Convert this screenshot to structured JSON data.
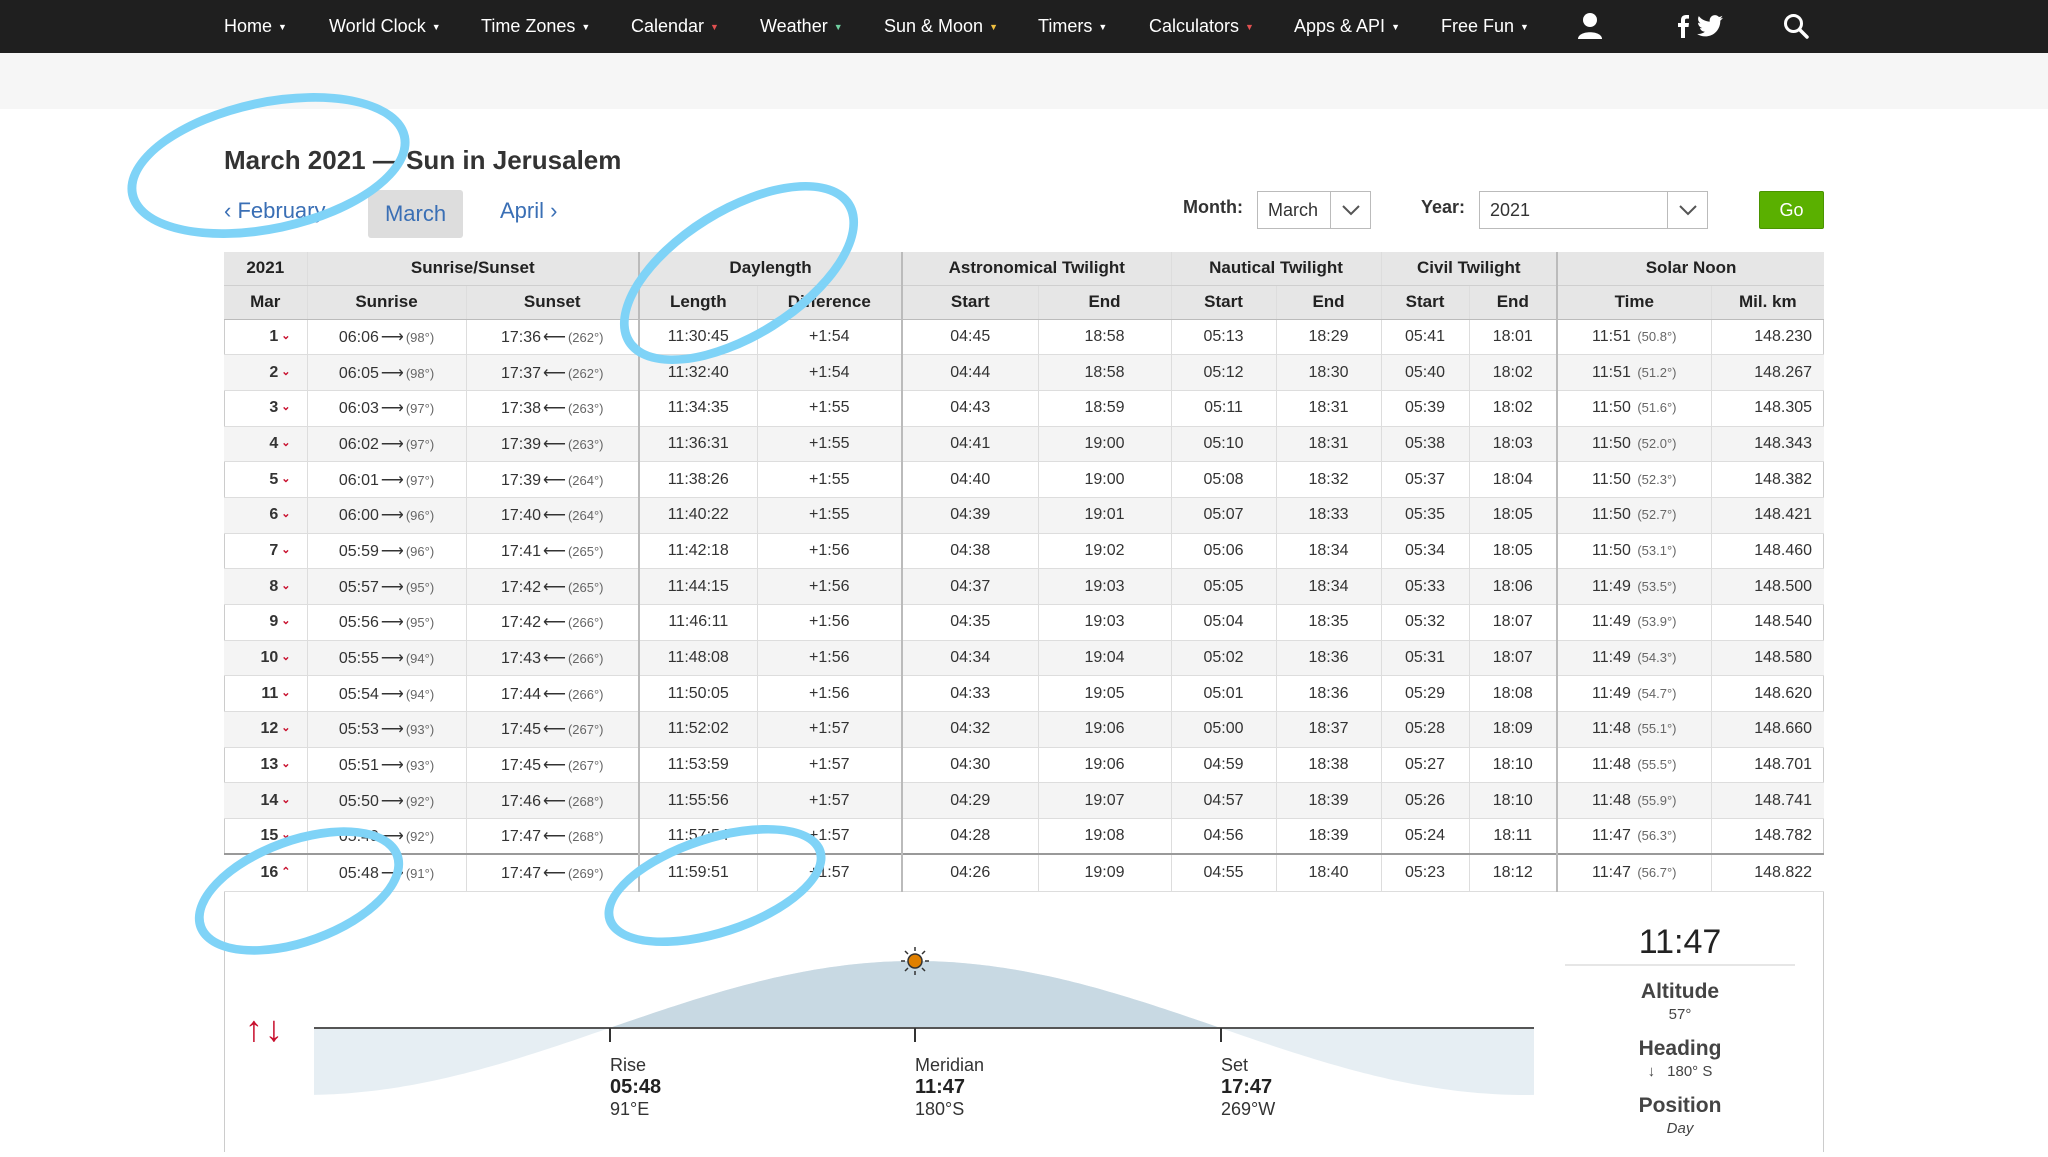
{
  "nav": {
    "items": [
      "Home",
      "World Clock",
      "Time Zones",
      "Calendar",
      "Weather",
      "Sun & Moon",
      "Timers",
      "Calculators",
      "Apps & API",
      "Free Fun"
    ],
    "icons": [
      "user-icon",
      "facebook-icon",
      "twitter-icon",
      "search-icon"
    ]
  },
  "page": {
    "title": "March 2021 — Sun in Jerusalem",
    "prev_month": "February",
    "current_month": "March",
    "next_month": "April"
  },
  "form": {
    "month_label": "Month:",
    "month_value": "March",
    "year_label": "Year:",
    "year_value": "2021",
    "go_label": "Go"
  },
  "table": {
    "group_headers": [
      "2021",
      "Sunrise/Sunset",
      "Daylength",
      "Astronomical Twilight",
      "Nautical Twilight",
      "Civil Twilight",
      "Solar Noon"
    ],
    "col_headers": [
      "Mar",
      "Sunrise",
      "Sunset",
      "Length",
      "Difference",
      "Start",
      "End",
      "Start",
      "End",
      "Start",
      "End",
      "Time",
      "Mil. km"
    ],
    "rows": [
      {
        "day": "1",
        "sunrise": "06:06",
        "sr_az": "(98°)",
        "sunset": "17:36",
        "ss_az": "(262°)",
        "length": "11:30:45",
        "diff": "+1:54",
        "astro_start": "04:45",
        "astro_end": "18:58",
        "naut_start": "05:13",
        "naut_end": "18:29",
        "civil_start": "05:41",
        "civil_end": "18:01",
        "noon": "11:51",
        "noon_alt": "(50.8°)",
        "dist": "148.230"
      },
      {
        "day": "2",
        "sunrise": "06:05",
        "sr_az": "(98°)",
        "sunset": "17:37",
        "ss_az": "(262°)",
        "length": "11:32:40",
        "diff": "+1:54",
        "astro_start": "04:44",
        "astro_end": "18:58",
        "naut_start": "05:12",
        "naut_end": "18:30",
        "civil_start": "05:40",
        "civil_end": "18:02",
        "noon": "11:51",
        "noon_alt": "(51.2°)",
        "dist": "148.267"
      },
      {
        "day": "3",
        "sunrise": "06:03",
        "sr_az": "(97°)",
        "sunset": "17:38",
        "ss_az": "(263°)",
        "length": "11:34:35",
        "diff": "+1:55",
        "astro_start": "04:43",
        "astro_end": "18:59",
        "naut_start": "05:11",
        "naut_end": "18:31",
        "civil_start": "05:39",
        "civil_end": "18:02",
        "noon": "11:50",
        "noon_alt": "(51.6°)",
        "dist": "148.305"
      },
      {
        "day": "4",
        "sunrise": "06:02",
        "sr_az": "(97°)",
        "sunset": "17:39",
        "ss_az": "(263°)",
        "length": "11:36:31",
        "diff": "+1:55",
        "astro_start": "04:41",
        "astro_end": "19:00",
        "naut_start": "05:10",
        "naut_end": "18:31",
        "civil_start": "05:38",
        "civil_end": "18:03",
        "noon": "11:50",
        "noon_alt": "(52.0°)",
        "dist": "148.343"
      },
      {
        "day": "5",
        "sunrise": "06:01",
        "sr_az": "(97°)",
        "sunset": "17:39",
        "ss_az": "(264°)",
        "length": "11:38:26",
        "diff": "+1:55",
        "astro_start": "04:40",
        "astro_end": "19:00",
        "naut_start": "05:08",
        "naut_end": "18:32",
        "civil_start": "05:37",
        "civil_end": "18:04",
        "noon": "11:50",
        "noon_alt": "(52.3°)",
        "dist": "148.382"
      },
      {
        "day": "6",
        "sunrise": "06:00",
        "sr_az": "(96°)",
        "sunset": "17:40",
        "ss_az": "(264°)",
        "length": "11:40:22",
        "diff": "+1:55",
        "astro_start": "04:39",
        "astro_end": "19:01",
        "naut_start": "05:07",
        "naut_end": "18:33",
        "civil_start": "05:35",
        "civil_end": "18:05",
        "noon": "11:50",
        "noon_alt": "(52.7°)",
        "dist": "148.421"
      },
      {
        "day": "7",
        "sunrise": "05:59",
        "sr_az": "(96°)",
        "sunset": "17:41",
        "ss_az": "(265°)",
        "length": "11:42:18",
        "diff": "+1:56",
        "astro_start": "04:38",
        "astro_end": "19:02",
        "naut_start": "05:06",
        "naut_end": "18:34",
        "civil_start": "05:34",
        "civil_end": "18:05",
        "noon": "11:50",
        "noon_alt": "(53.1°)",
        "dist": "148.460"
      },
      {
        "day": "8",
        "sunrise": "05:57",
        "sr_az": "(95°)",
        "sunset": "17:42",
        "ss_az": "(265°)",
        "length": "11:44:15",
        "diff": "+1:56",
        "astro_start": "04:37",
        "astro_end": "19:03",
        "naut_start": "05:05",
        "naut_end": "18:34",
        "civil_start": "05:33",
        "civil_end": "18:06",
        "noon": "11:49",
        "noon_alt": "(53.5°)",
        "dist": "148.500"
      },
      {
        "day": "9",
        "sunrise": "05:56",
        "sr_az": "(95°)",
        "sunset": "17:42",
        "ss_az": "(266°)",
        "length": "11:46:11",
        "diff": "+1:56",
        "astro_start": "04:35",
        "astro_end": "19:03",
        "naut_start": "05:04",
        "naut_end": "18:35",
        "civil_start": "05:32",
        "civil_end": "18:07",
        "noon": "11:49",
        "noon_alt": "(53.9°)",
        "dist": "148.540"
      },
      {
        "day": "10",
        "sunrise": "05:55",
        "sr_az": "(94°)",
        "sunset": "17:43",
        "ss_az": "(266°)",
        "length": "11:48:08",
        "diff": "+1:56",
        "astro_start": "04:34",
        "astro_end": "19:04",
        "naut_start": "05:02",
        "naut_end": "18:36",
        "civil_start": "05:31",
        "civil_end": "18:07",
        "noon": "11:49",
        "noon_alt": "(54.3°)",
        "dist": "148.580"
      },
      {
        "day": "11",
        "sunrise": "05:54",
        "sr_az": "(94°)",
        "sunset": "17:44",
        "ss_az": "(266°)",
        "length": "11:50:05",
        "diff": "+1:56",
        "astro_start": "04:33",
        "astro_end": "19:05",
        "naut_start": "05:01",
        "naut_end": "18:36",
        "civil_start": "05:29",
        "civil_end": "18:08",
        "noon": "11:49",
        "noon_alt": "(54.7°)",
        "dist": "148.620"
      },
      {
        "day": "12",
        "sunrise": "05:53",
        "sr_az": "(93°)",
        "sunset": "17:45",
        "ss_az": "(267°)",
        "length": "11:52:02",
        "diff": "+1:57",
        "astro_start": "04:32",
        "astro_end": "19:06",
        "naut_start": "05:00",
        "naut_end": "18:37",
        "civil_start": "05:28",
        "civil_end": "18:09",
        "noon": "11:48",
        "noon_alt": "(55.1°)",
        "dist": "148.660"
      },
      {
        "day": "13",
        "sunrise": "05:51",
        "sr_az": "(93°)",
        "sunset": "17:45",
        "ss_az": "(267°)",
        "length": "11:53:59",
        "diff": "+1:57",
        "astro_start": "04:30",
        "astro_end": "19:06",
        "naut_start": "04:59",
        "naut_end": "18:38",
        "civil_start": "05:27",
        "civil_end": "18:10",
        "noon": "11:48",
        "noon_alt": "(55.5°)",
        "dist": "148.701"
      },
      {
        "day": "14",
        "sunrise": "05:50",
        "sr_az": "(92°)",
        "sunset": "17:46",
        "ss_az": "(268°)",
        "length": "11:55:56",
        "diff": "+1:57",
        "astro_start": "04:29",
        "astro_end": "19:07",
        "naut_start": "04:57",
        "naut_end": "18:39",
        "civil_start": "05:26",
        "civil_end": "18:10",
        "noon": "11:48",
        "noon_alt": "(55.9°)",
        "dist": "148.741"
      },
      {
        "day": "15",
        "sunrise": "05:49",
        "sr_az": "(92°)",
        "sunset": "17:47",
        "ss_az": "(268°)",
        "length": "11:57:54",
        "diff": "+1:57",
        "astro_start": "04:28",
        "astro_end": "19:08",
        "naut_start": "04:56",
        "naut_end": "18:39",
        "civil_start": "05:24",
        "civil_end": "18:11",
        "noon": "11:47",
        "noon_alt": "(56.3°)",
        "dist": "148.782"
      },
      {
        "day": "16",
        "sunrise": "05:48",
        "sr_az": "(91°)",
        "sunset": "17:47",
        "ss_az": "(269°)",
        "length": "11:59:51",
        "diff": "+1:57",
        "astro_start": "04:26",
        "astro_end": "19:09",
        "naut_start": "04:55",
        "naut_end": "18:40",
        "civil_start": "05:23",
        "civil_end": "18:12",
        "noon": "11:47",
        "noon_alt": "(56.7°)",
        "dist": "148.822"
      }
    ],
    "expanded_day_index": 15
  },
  "sun_graph": {
    "rise": {
      "label": "Rise",
      "time": "05:48",
      "dir": "91°E"
    },
    "meridian": {
      "label": "Meridian",
      "time": "11:47",
      "dir": "180°S"
    },
    "set": {
      "label": "Set",
      "time": "17:47",
      "dir": "269°W"
    },
    "colors": {
      "day": "#c8d9e3",
      "night": "#e6eef3",
      "accent": "#c8102e",
      "sun": "#e08000"
    }
  },
  "side": {
    "time": "11:47",
    "altitude_label": "Altitude",
    "altitude_value": "57°",
    "heading_label": "Heading",
    "heading_value": "180° S",
    "position_label": "Position",
    "position_value": "Day"
  },
  "annotations": {
    "color": "#7fd3f7",
    "count": 4
  }
}
